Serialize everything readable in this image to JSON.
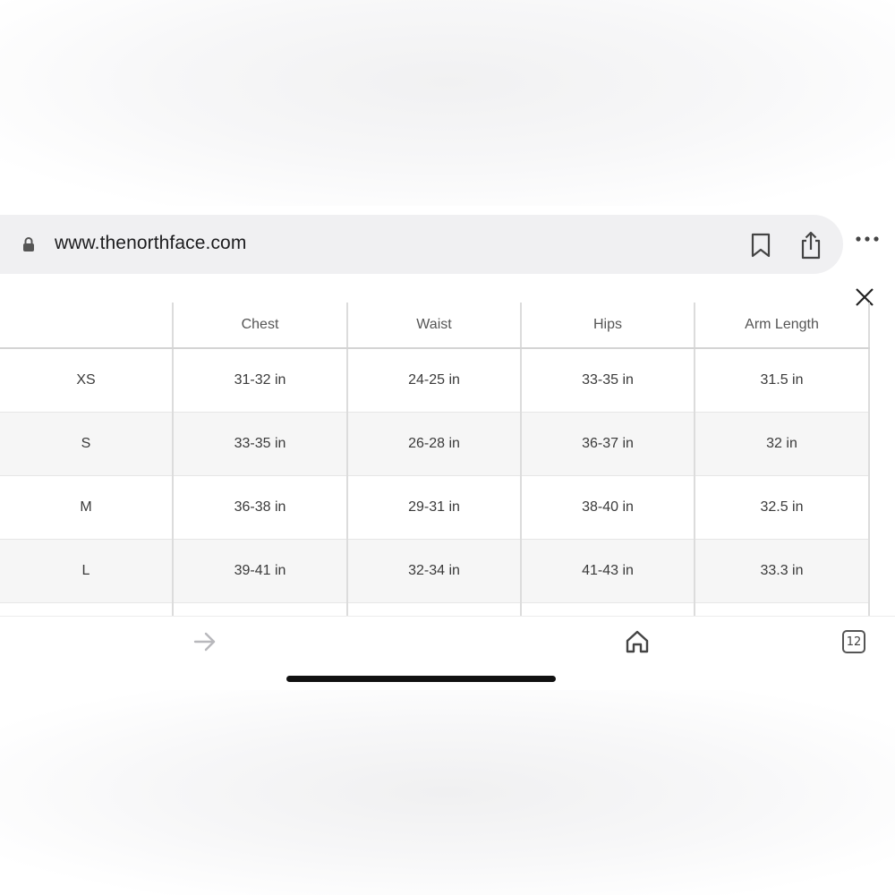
{
  "browser": {
    "url": "www.thenorthface.com",
    "tab_count": "12"
  },
  "size_table": {
    "headers": [
      "",
      "Chest",
      "Waist",
      "Hips",
      "Arm Length"
    ],
    "rows": [
      {
        "size": "XS",
        "chest": "31-32 in",
        "waist": "24-25 in",
        "hips": "33-35 in",
        "arm_length": "31.5 in"
      },
      {
        "size": "S",
        "chest": "33-35 in",
        "waist": "26-28 in",
        "hips": "36-37 in",
        "arm_length": "32 in"
      },
      {
        "size": "M",
        "chest": "36-38 in",
        "waist": "29-31 in",
        "hips": "38-40 in",
        "arm_length": "32.5 in"
      },
      {
        "size": "L",
        "chest": "39-41 in",
        "waist": "32-34 in",
        "hips": "41-43 in",
        "arm_length": "33.3 in"
      }
    ]
  },
  "icons": {
    "lock": "lock-icon",
    "bookmark": "bookmark-icon",
    "share": "share-icon",
    "more": "more-icon",
    "close": "close-icon",
    "forward": "forward-icon",
    "home": "home-icon"
  },
  "colors": {
    "address_bar_bg": "#f0f0f2",
    "row_alt_bg": "#f6f6f6",
    "grid_line": "#dcdcdc"
  }
}
